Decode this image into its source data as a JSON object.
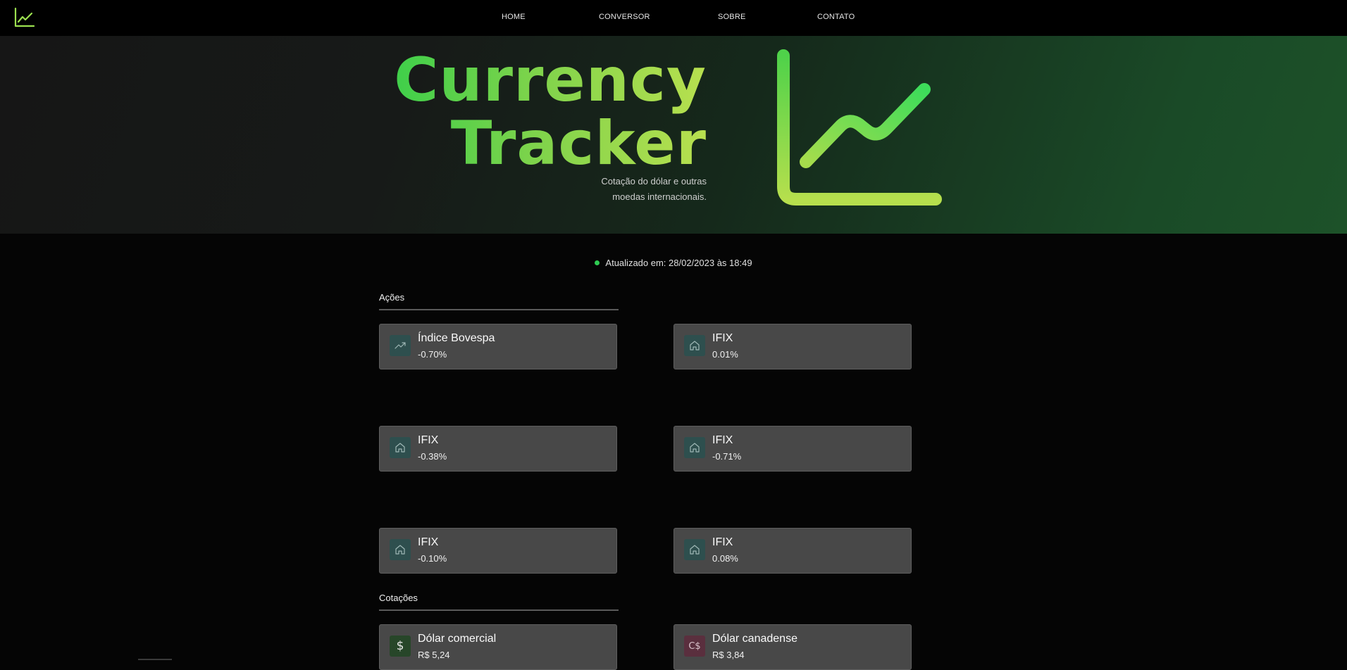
{
  "nav": {
    "links": [
      "HOME",
      "CONVERSOR",
      "SOBRE",
      "CONTATO"
    ]
  },
  "hero": {
    "title_line1": "Currency",
    "title_line2": "Tracker",
    "subtitle_line1": "Cotação do dólar e outras",
    "subtitle_line2": "moedas internacionais."
  },
  "status": {
    "text": "Atualizado em: 28/02/2023 às 18:49"
  },
  "acoes": {
    "title": "Ações",
    "cards": [
      {
        "name": "Índice Bovespa",
        "value": "-0.70%",
        "icon": "trending-up-icon"
      },
      {
        "name": "IFIX",
        "value": "0.01%",
        "icon": "house-icon"
      },
      {
        "name": "IFIX",
        "value": "-0.38%",
        "icon": "house-icon"
      },
      {
        "name": "IFIX",
        "value": "-0.71%",
        "icon": "house-icon"
      },
      {
        "name": "IFIX",
        "value": "-0.10%",
        "icon": "house-icon"
      },
      {
        "name": "IFIX",
        "value": "0.08%",
        "icon": "house-icon"
      }
    ]
  },
  "cotacoes": {
    "title": "Cotações",
    "cards": [
      {
        "name": "Dólar comercial",
        "value": "R$ 5,24",
        "icon": "dollar-icon"
      },
      {
        "name": "Dólar canadense",
        "value": "R$ 3,84",
        "icon": "canadian-dollar-icon"
      }
    ]
  },
  "colors": {
    "accent_green": "#3fcf4a",
    "accent_lime": "#b8e04f",
    "card_bg": "#484848",
    "status_dot": "#2ecc52"
  }
}
